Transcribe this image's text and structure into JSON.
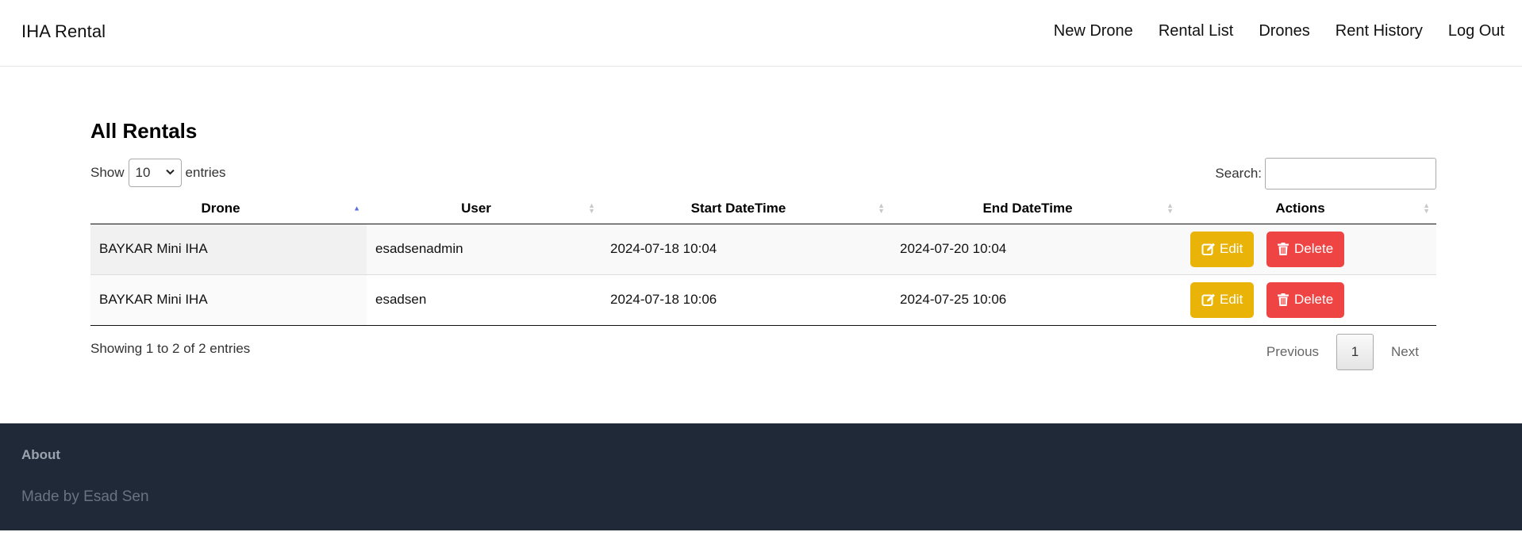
{
  "navbar": {
    "brand": "IHA Rental",
    "links": [
      "New Drone",
      "Rental List",
      "Drones",
      "Rent History",
      "Log Out"
    ]
  },
  "main": {
    "title": "All Rentals",
    "length": {
      "prefix": "Show",
      "value": "10",
      "suffix": "entries"
    },
    "search": {
      "label": "Search:",
      "value": "",
      "placeholder": ""
    },
    "table": {
      "columns": [
        "Drone",
        "User",
        "Start DateTime",
        "End DateTime",
        "Actions"
      ],
      "sorted_column": "Drone",
      "sort_direction": "ascending",
      "rows": [
        {
          "drone": "BAYKAR Mini IHA",
          "user": "esadsenadmin",
          "start": "2024-07-18 10:04",
          "end": "2024-07-20 10:04"
        },
        {
          "drone": "BAYKAR Mini IHA",
          "user": "esadsen",
          "start": "2024-07-18 10:06",
          "end": "2024-07-25 10:06"
        }
      ],
      "edit_label": "Edit",
      "delete_label": "Delete"
    },
    "info": "Showing 1 to 2 of 2 entries",
    "pagination": {
      "previous": "Previous",
      "current": "1",
      "next": "Next"
    }
  },
  "footer": {
    "title": "About",
    "text": "Made by Esad Sen"
  },
  "colors": {
    "edit": "#eab308",
    "delete": "#ef4444",
    "footer_bg": "#1f2937",
    "sort_active": "#5b6ee1"
  },
  "icons": {
    "edit": "edit-icon",
    "delete": "trash-icon",
    "select": "chevron-down-icon",
    "sort": "sort-icon"
  }
}
